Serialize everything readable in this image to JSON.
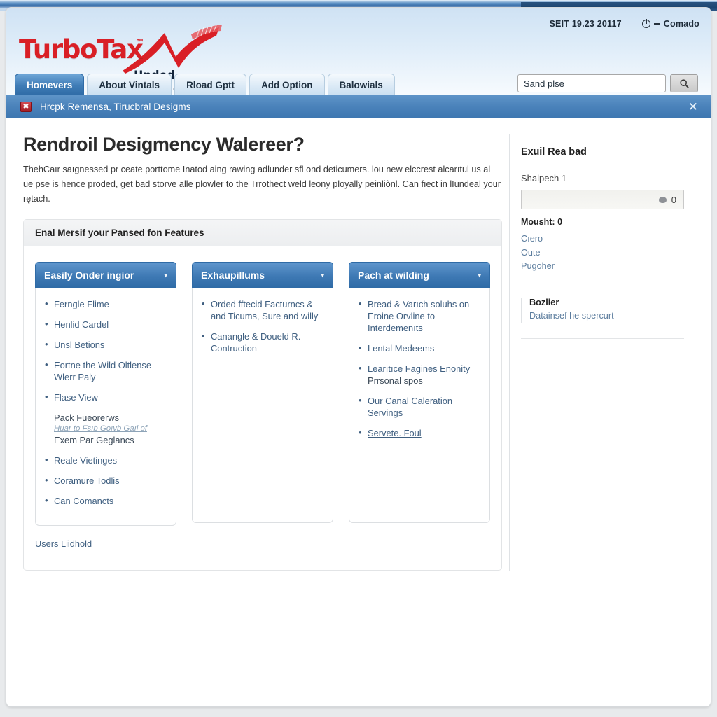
{
  "header": {
    "utility": {
      "session_text": "SEIT 19.23 20117",
      "account_label": "Comado",
      "power_icon": "power-icon"
    },
    "logo": {
      "main": "TurboTax",
      "tm": "™",
      "sub": "Unded Freeviens"
    },
    "tabs": [
      {
        "label": "Homevers",
        "active": true
      },
      {
        "label": "About Vintals",
        "active": false
      },
      {
        "label": "Rload Gptt",
        "active": false
      },
      {
        "label": "Add Option",
        "active": false
      },
      {
        "label": "Balowials",
        "active": false
      }
    ],
    "search": {
      "value": "Sand plse",
      "placeholder": "Sand plse",
      "button_icon": "search-icon"
    }
  },
  "notification": {
    "icon": "alert-icon",
    "icon_glyph": "✖",
    "text": "Hrcpk Remensa, Tirucbral Desigms",
    "close_glyph": "✕"
  },
  "main": {
    "title": "Rendroil Desigmency Walereer?",
    "intro": "ThehCaır saıgnessed pr ceate porttome Inatod aing rawing adlunder sfl ond deticumers. lou new elccrest alcarıtul us аl ue pse is hence proded, get bad storve alle plowler to the Trrothect weld leony ployally peinliònl. Can fıect in lIundeal your rętach.",
    "panel_header": "Enal Mersif your Pansed fon Features",
    "footer_link": "Users Liidhold",
    "cards": [
      {
        "title": "Easily Onder ingior",
        "chevron": "▾",
        "items": [
          {
            "text": "Ferngle Flime",
            "style": "bullet"
          },
          {
            "text": "Henlid Cardel",
            "style": "bullet"
          },
          {
            "text": "Unsl Betions",
            "style": "bullet"
          },
          {
            "text": "Eortne the Wild Oltlense Wlerr Paly",
            "style": "bullet"
          },
          {
            "text": "Flase View",
            "style": "bullet"
          },
          {
            "text": "Pack Fueorerws",
            "style": "plain",
            "sub_italic": "Huar to Fsıb Goıvb Gaıl of",
            "sub_plain": "Exem Par Geglancs"
          },
          {
            "text": "Reale Vietinges",
            "style": "bullet"
          },
          {
            "text": "Coramure Todlis",
            "style": "bullet"
          },
          {
            "text": "Can Comancts",
            "style": "bullet"
          }
        ]
      },
      {
        "title": "Exhaupillums",
        "chevron": "▾",
        "items": [
          {
            "text": "Orded fftecid Facturncs & and Ticums, Sure and willy",
            "style": "bullet"
          },
          {
            "text": "Canangle & Doueld R. Contruction",
            "style": "bullet"
          }
        ]
      },
      {
        "title": "Pach at wilding",
        "chevron": "▾",
        "items": [
          {
            "text": "Bread & Varıch soluhs on Eroine Orvline to Interdemenıts",
            "style": "bullet"
          },
          {
            "text": "Lental Medeems",
            "style": "bullet"
          },
          {
            "text": "Learıtıce Fagines Enonity",
            "style": "bullet",
            "sub_plain": "Prrsonal spos"
          },
          {
            "text": "Our Canal Caleration Servings",
            "style": "bullet"
          },
          {
            "text": "Servete. Foul",
            "style": "bullet-link"
          }
        ]
      }
    ]
  },
  "sidebar": {
    "title": "Exuil Rea bad",
    "field_label": "Shalpech 1",
    "field_value": "0",
    "field_icon": "cloud-icon",
    "count_label": "Mousht:",
    "count_value": "0",
    "links": [
      "Cıero",
      "Oute",
      "Pugoher"
    ],
    "block_title": "Bozlier",
    "block_link": "Datainsef he spercurt"
  },
  "colors": {
    "brand_red": "#d91f26",
    "accent_blue": "#3e79b4",
    "tab_active": "#2f6ba6",
    "link_blue": "#3f5f80",
    "notice_bg": "#4a82ba"
  }
}
